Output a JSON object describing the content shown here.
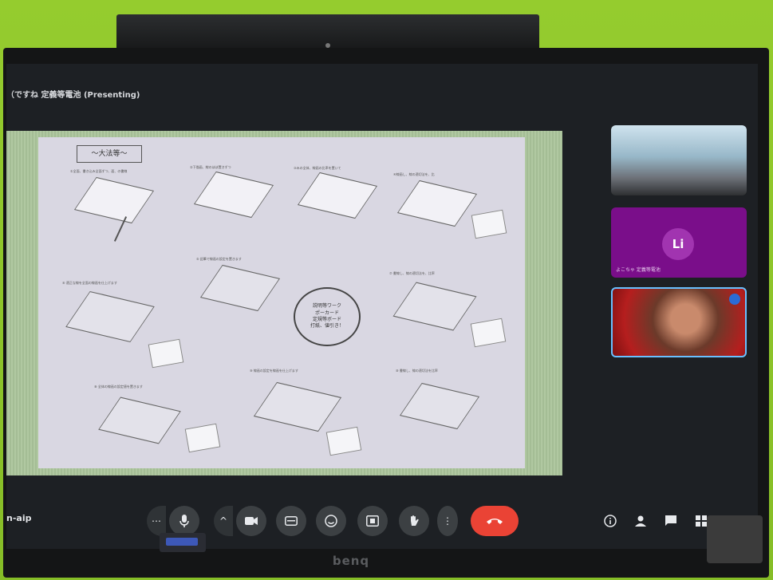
{
  "meeting": {
    "presenter_title": "（ですね 定義等電池 (Presenting)",
    "meeting_code": "n-aip"
  },
  "slide": {
    "header": "〜大法等〜",
    "circle_note": "説明等ワーク\nポーカード\n定規等ボード\n打紙、値引き！",
    "steps": [
      {
        "caption": "①全面、書き込み全面ずつ、面、の書線"
      },
      {
        "caption": "②下描画、線のほぼ置きずつ"
      },
      {
        "caption": "③みの全体、線画の比率を置いて"
      },
      {
        "caption": "④線画し、線の適切法を、比"
      },
      {
        "caption": "⑤ 鉛筆で線画の設定を置きます"
      },
      {
        "caption": "⑥ 適正な線を全面の線画を仕上げます"
      },
      {
        "caption": "⑦ 書線し、線の適切法を、比率"
      },
      {
        "caption": "⑧ 全体の線画の設定値を置きます"
      },
      {
        "caption": "⑨ 線画の設定を線画を仕上げます"
      },
      {
        "caption": "⑩ 書線し、線の適切法を比率"
      }
    ]
  },
  "participants": [
    {
      "name": ""
    },
    {
      "initial": "Li",
      "name": "よこちゃ 定義等電池"
    },
    {
      "name": ""
    }
  ],
  "controls": {
    "more_label": "⋯",
    "mic_icon": "mic-icon",
    "caret_label": "^",
    "camera_icon": "camera-icon",
    "captions_icon": "captions-icon",
    "emoji_icon": "emoji-icon",
    "present_icon": "present-icon",
    "hand_icon": "raise-hand-icon",
    "overflow_label": "⋮",
    "end_call_icon": "end-call-icon",
    "info_icon": "info-icon",
    "people_icon": "people-icon",
    "chat_icon": "chat-icon",
    "activities_icon": "activities-icon"
  },
  "monitor": {
    "brand": "benq"
  }
}
